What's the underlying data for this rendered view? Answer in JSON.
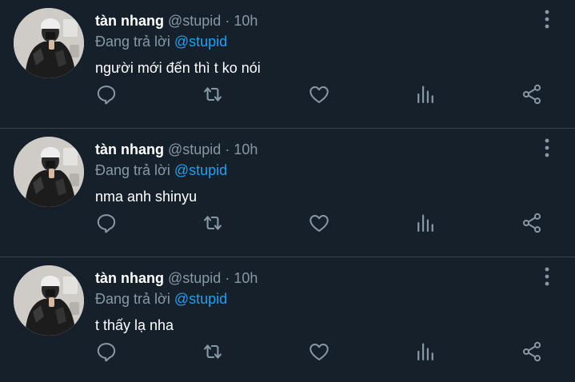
{
  "tweets": [
    {
      "name": "tàn nhang",
      "handle": "@stupid",
      "separator": "·",
      "time": "10h",
      "reply_prefix": "Đang trả lời",
      "reply_to": "@stupid",
      "text": "người mới đến thì t ko nói"
    },
    {
      "name": "tàn nhang",
      "handle": "@stupid",
      "separator": "·",
      "time": "10h",
      "reply_prefix": "Đang trả lời",
      "reply_to": "@stupid",
      "text": "nma anh shinyu"
    },
    {
      "name": "tàn nhang",
      "handle": "@stupid",
      "separator": "·",
      "time": "10h",
      "reply_prefix": "Đang trả lời",
      "reply_to": "@stupid",
      "text": "t thấy lạ nha"
    }
  ],
  "icons": {
    "reply": "comment-icon",
    "retweet": "retweet-icon",
    "like": "heart-icon",
    "analytics": "analytics-icon",
    "share": "share-icon",
    "more": "more-vertical-icon"
  },
  "colors": {
    "background": "#15202b",
    "divider": "#38444d",
    "secondary_text": "#8899a6",
    "mention": "#1da1f2",
    "icon": "#8899a6"
  }
}
